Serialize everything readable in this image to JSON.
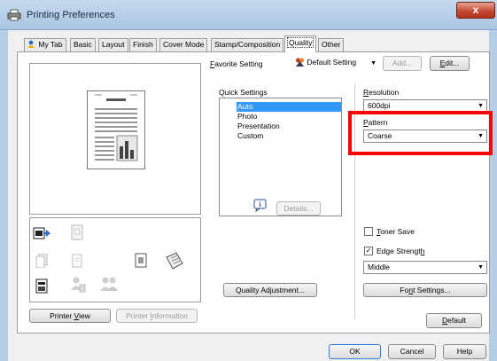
{
  "window": {
    "title": "Printing Preferences",
    "close_label": "x"
  },
  "tabs": [
    {
      "label": "My Tab"
    },
    {
      "label": "Basic"
    },
    {
      "label": "Layout"
    },
    {
      "label": "Finish"
    },
    {
      "label": "Cover Mode"
    },
    {
      "label": "Stamp/Composition"
    },
    {
      "label": "Quality",
      "active": true
    },
    {
      "label": "Other"
    }
  ],
  "favorite": {
    "label_prefix": "F",
    "label_rest": "avorite Setting",
    "value": "Default Setting",
    "add_label": "Add...",
    "edit_prefix": "E",
    "edit_rest": "dit..."
  },
  "quick_settings": {
    "label": "Quick Settings",
    "items": [
      "Auto",
      "Photo",
      "Presentation",
      "Custom"
    ],
    "selected": "Auto",
    "details_label": "Details..."
  },
  "resolution": {
    "label_prefix": "R",
    "label_rest": "esolution",
    "value": "600dpi"
  },
  "pattern": {
    "label_prefix": "P",
    "label_rest": "attern",
    "value": "Coarse"
  },
  "toner_save": {
    "label_prefix": "T",
    "label_rest": "oner Save",
    "checked": false
  },
  "edge_strength": {
    "label_pre": "Edge Strengt",
    "label_u": "h",
    "checked": true,
    "value": "Middle"
  },
  "buttons": {
    "quality_adjustment": {
      "pre": "Quality Ad",
      "u": "j",
      "post": "ustment..."
    },
    "font_settings": {
      "pre": "Fo",
      "u": "n",
      "post": "t Settings..."
    },
    "printer_view": {
      "pre": "Printer ",
      "u": "V",
      "post": "iew"
    },
    "printer_information": {
      "pre": "Printer ",
      "u": "I",
      "post": "nformation"
    },
    "default": {
      "u": "D",
      "post": "efault"
    },
    "ok": "OK",
    "cancel": "Cancel",
    "help": "Help"
  },
  "colors": {
    "accent_highlight": "#ff0000",
    "selection": "#3399ff"
  }
}
